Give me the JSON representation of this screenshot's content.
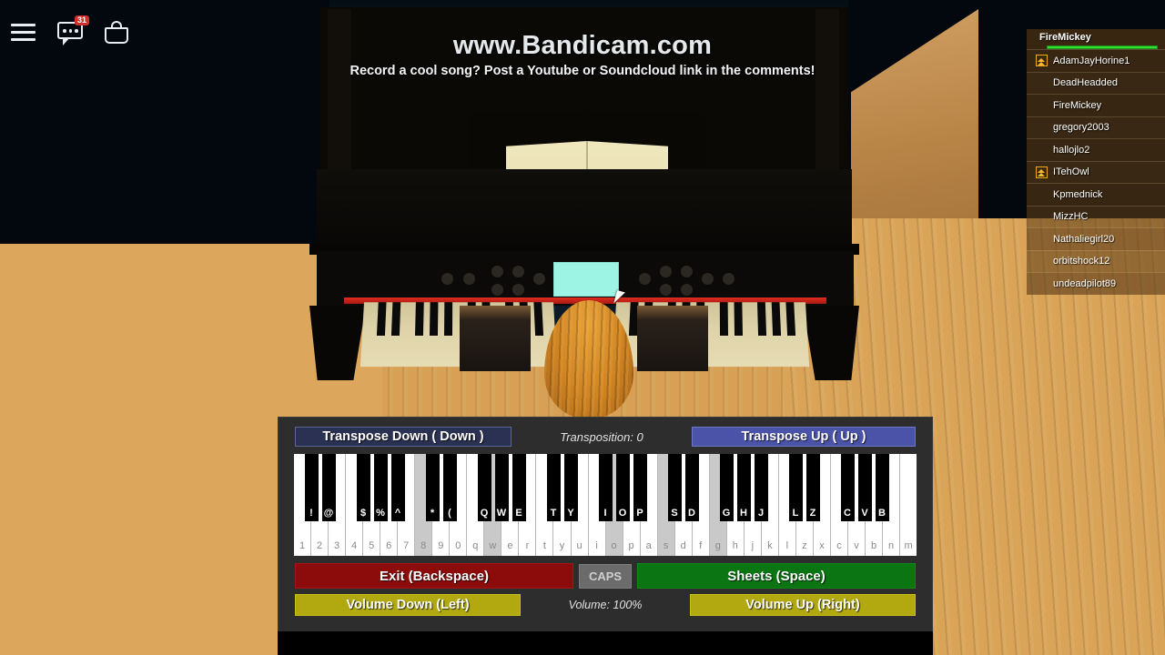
{
  "hud": {
    "menu_icon": "hamburger-menu-icon",
    "chat_icon": "chat-icon",
    "chat_badge": "31",
    "backpack_icon": "backpack-icon"
  },
  "watermark": {
    "url": "www.Bandicam.com",
    "subtitle": "Record a cool song? Post a Youtube or Soundcloud link in the comments!"
  },
  "playerlist": {
    "local_player": "FireMickey",
    "health_color": "#2ee02e",
    "players": [
      {
        "name": "AdamJayHorine1",
        "rank": true
      },
      {
        "name": "DeadHeadded",
        "rank": false
      },
      {
        "name": "FireMickey",
        "rank": false
      },
      {
        "name": "gregory2003",
        "rank": false
      },
      {
        "name": "hallojlo2",
        "rank": false
      },
      {
        "name": "ITehOwl",
        "rank": true
      },
      {
        "name": "Kpmednick",
        "rank": false
      },
      {
        "name": "MizzHC",
        "rank": false
      },
      {
        "name": "Nathaliegirl20",
        "rank": false
      },
      {
        "name": "orbitshock12",
        "rank": false
      },
      {
        "name": "undeadpilot89",
        "rank": false
      }
    ]
  },
  "piano_gui": {
    "transpose_down_label": "Transpose Down ( Down )",
    "transpose_up_label": "Transpose Up (  Up  )",
    "transposition_label": "Transposition: 0",
    "exit_label": "Exit (Backspace)",
    "caps_label": "CAPS",
    "sheets_label": "Sheets (Space)",
    "volume_down_label": "Volume Down (Left)",
    "volume_label": "Volume: 100%",
    "volume_up_label": "Volume Up (Right)",
    "colors": {
      "transpose_down": "#2a3152",
      "transpose_up": "#4a53a8",
      "exit": "#8c0b0b",
      "sheets": "#0a7512",
      "volume": "#b1a90f",
      "panel": "#2d2d2d"
    },
    "white_keys": [
      {
        "label": "1",
        "highlighted": false
      },
      {
        "label": "2",
        "highlighted": false
      },
      {
        "label": "3",
        "highlighted": false
      },
      {
        "label": "4",
        "highlighted": false
      },
      {
        "label": "5",
        "highlighted": false
      },
      {
        "label": "6",
        "highlighted": false
      },
      {
        "label": "7",
        "highlighted": false
      },
      {
        "label": "8",
        "highlighted": true
      },
      {
        "label": "9",
        "highlighted": false
      },
      {
        "label": "0",
        "highlighted": false
      },
      {
        "label": "q",
        "highlighted": false
      },
      {
        "label": "w",
        "highlighted": true
      },
      {
        "label": "e",
        "highlighted": false
      },
      {
        "label": "r",
        "highlighted": false
      },
      {
        "label": "t",
        "highlighted": false
      },
      {
        "label": "y",
        "highlighted": false
      },
      {
        "label": "u",
        "highlighted": false
      },
      {
        "label": "i",
        "highlighted": false
      },
      {
        "label": "o",
        "highlighted": true
      },
      {
        "label": "p",
        "highlighted": false
      },
      {
        "label": "a",
        "highlighted": false
      },
      {
        "label": "s",
        "highlighted": true
      },
      {
        "label": "d",
        "highlighted": false
      },
      {
        "label": "f",
        "highlighted": false
      },
      {
        "label": "g",
        "highlighted": true
      },
      {
        "label": "h",
        "highlighted": false
      },
      {
        "label": "j",
        "highlighted": false
      },
      {
        "label": "k",
        "highlighted": false
      },
      {
        "label": "l",
        "highlighted": false
      },
      {
        "label": "z",
        "highlighted": false
      },
      {
        "label": "x",
        "highlighted": false
      },
      {
        "label": "c",
        "highlighted": false
      },
      {
        "label": "v",
        "highlighted": false
      },
      {
        "label": "b",
        "highlighted": false
      },
      {
        "label": "n",
        "highlighted": false
      },
      {
        "label": "m",
        "highlighted": false
      }
    ],
    "black_keys": [
      {
        "label": "!",
        "after_white": 0
      },
      {
        "label": "@",
        "after_white": 1
      },
      {
        "label": "$",
        "after_white": 3
      },
      {
        "label": "%",
        "after_white": 4
      },
      {
        "label": "^",
        "after_white": 5
      },
      {
        "label": "*",
        "after_white": 7
      },
      {
        "label": "(",
        "after_white": 8
      },
      {
        "label": "Q",
        "after_white": 10
      },
      {
        "label": "W",
        "after_white": 11
      },
      {
        "label": "E",
        "after_white": 12
      },
      {
        "label": "T",
        "after_white": 14
      },
      {
        "label": "Y",
        "after_white": 15
      },
      {
        "label": "I",
        "after_white": 17
      },
      {
        "label": "O",
        "after_white": 18
      },
      {
        "label": "P",
        "after_white": 19
      },
      {
        "label": "S",
        "after_white": 21
      },
      {
        "label": "D",
        "after_white": 22
      },
      {
        "label": "G",
        "after_white": 24
      },
      {
        "label": "H",
        "after_white": 25
      },
      {
        "label": "J",
        "after_white": 26
      },
      {
        "label": "L",
        "after_white": 28
      },
      {
        "label": "Z",
        "after_white": 29
      },
      {
        "label": "C",
        "after_white": 31
      },
      {
        "label": "V",
        "after_white": 32
      },
      {
        "label": "B",
        "after_white": 33
      }
    ]
  },
  "scene": {
    "display_color": "#9df4e4",
    "rail_color": "#e02b1e",
    "cursor": "mouse-cursor"
  }
}
